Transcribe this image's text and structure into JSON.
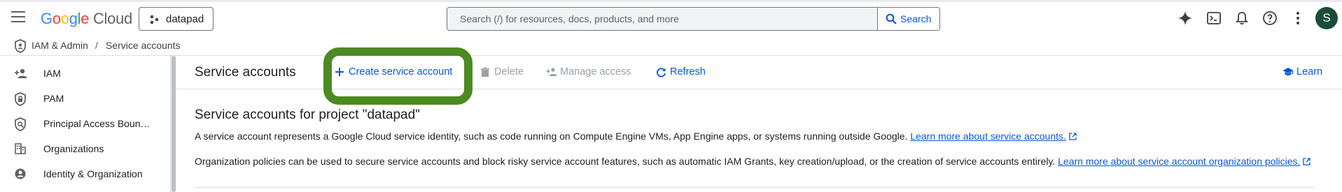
{
  "header": {
    "logo": {
      "google": "Google",
      "cloud": "Cloud"
    },
    "project": {
      "name": "datapad"
    },
    "search": {
      "placeholder": "Search (/) for resources, docs, products, and more",
      "button_label": "Search"
    },
    "icons": [
      "gemini-sparkle-icon",
      "cloud-shell-icon",
      "notifications-bell-icon",
      "help-icon",
      "more-vert-icon"
    ],
    "avatar_initial": "S"
  },
  "breadcrumb": {
    "section": "IAM & Admin",
    "separator": "/",
    "page": "Service accounts"
  },
  "sidebar": {
    "items": [
      {
        "label": "IAM",
        "icon": "person-add-icon"
      },
      {
        "label": "PAM",
        "icon": "shield-lock-icon"
      },
      {
        "label": "Principal Access Boun…",
        "icon": "policy-icon"
      },
      {
        "label": "Organizations",
        "icon": "domain-icon"
      },
      {
        "label": "Identity & Organization",
        "icon": "account-circle-icon"
      }
    ]
  },
  "toolbar": {
    "title": "Service accounts",
    "create_label": "Create service account",
    "delete_label": "Delete",
    "manage_access_label": "Manage access",
    "refresh_label": "Refresh",
    "learn_label": "Learn"
  },
  "content": {
    "heading": "Service accounts for project \"datapad\"",
    "para1_text": "A service account represents a Google Cloud service identity, such as code running on Compute Engine VMs, App Engine apps, or systems running outside Google.",
    "para1_link": "Learn more about service accounts.",
    "para2_text": "Organization policies can be used to secure service accounts and block risky service account features, such as automatic IAM Grants, key creation/upload, or the creation of service accounts entirely.",
    "para2_link": "Learn more about service account organization policies."
  },
  "colors": {
    "link": "#0b57d0",
    "disabled": "#9aa0a6",
    "highlight": "#4d8a22",
    "avatar": "#1a4d3a"
  }
}
